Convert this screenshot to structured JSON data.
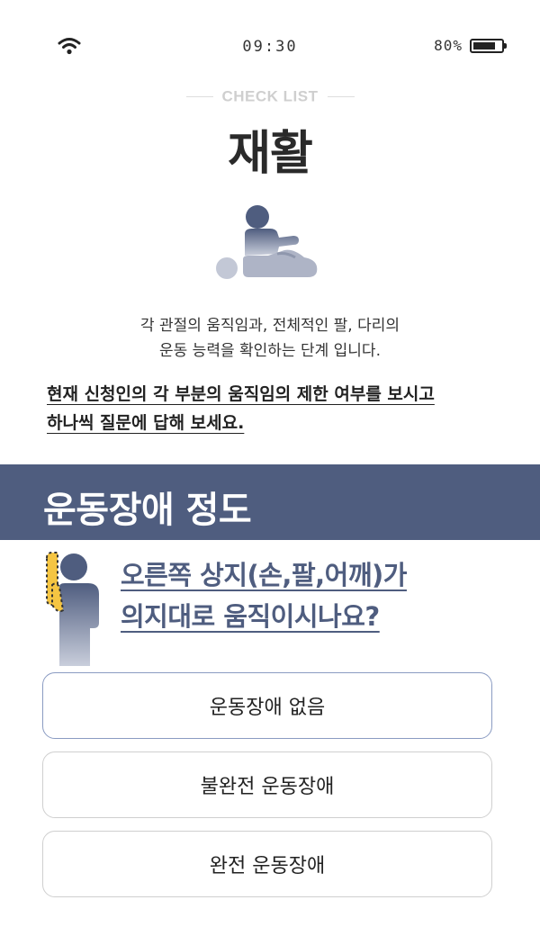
{
  "status_bar": {
    "time": "09:30",
    "battery_percent": "80%",
    "battery_level": 0.8
  },
  "header": {
    "eyebrow": "CHECK LIST",
    "title": "재활"
  },
  "intro": {
    "line1": "각 관절의 움직임과, 전체적인 팔, 다리의",
    "line2": "운동 능력을 확인하는 단계 입니다.",
    "instruction_line1": "현재 신청인의 각 부분의 움직임의 제한 여부를 보시고",
    "instruction_line2": "하나씩 질문에 답해 보세요."
  },
  "section": {
    "title": "운동장애 정도"
  },
  "question": {
    "line1": "오른쪽 상지(손,팔,어깨)가",
    "line2": "의지대로 움직이시나요?"
  },
  "options": [
    {
      "label": "운동장애 없음"
    },
    {
      "label": "불완전 운동장애"
    },
    {
      "label": "완전 운동장애"
    }
  ],
  "colors": {
    "accent": "#4f5d7f",
    "highlight": "#f5c542"
  }
}
